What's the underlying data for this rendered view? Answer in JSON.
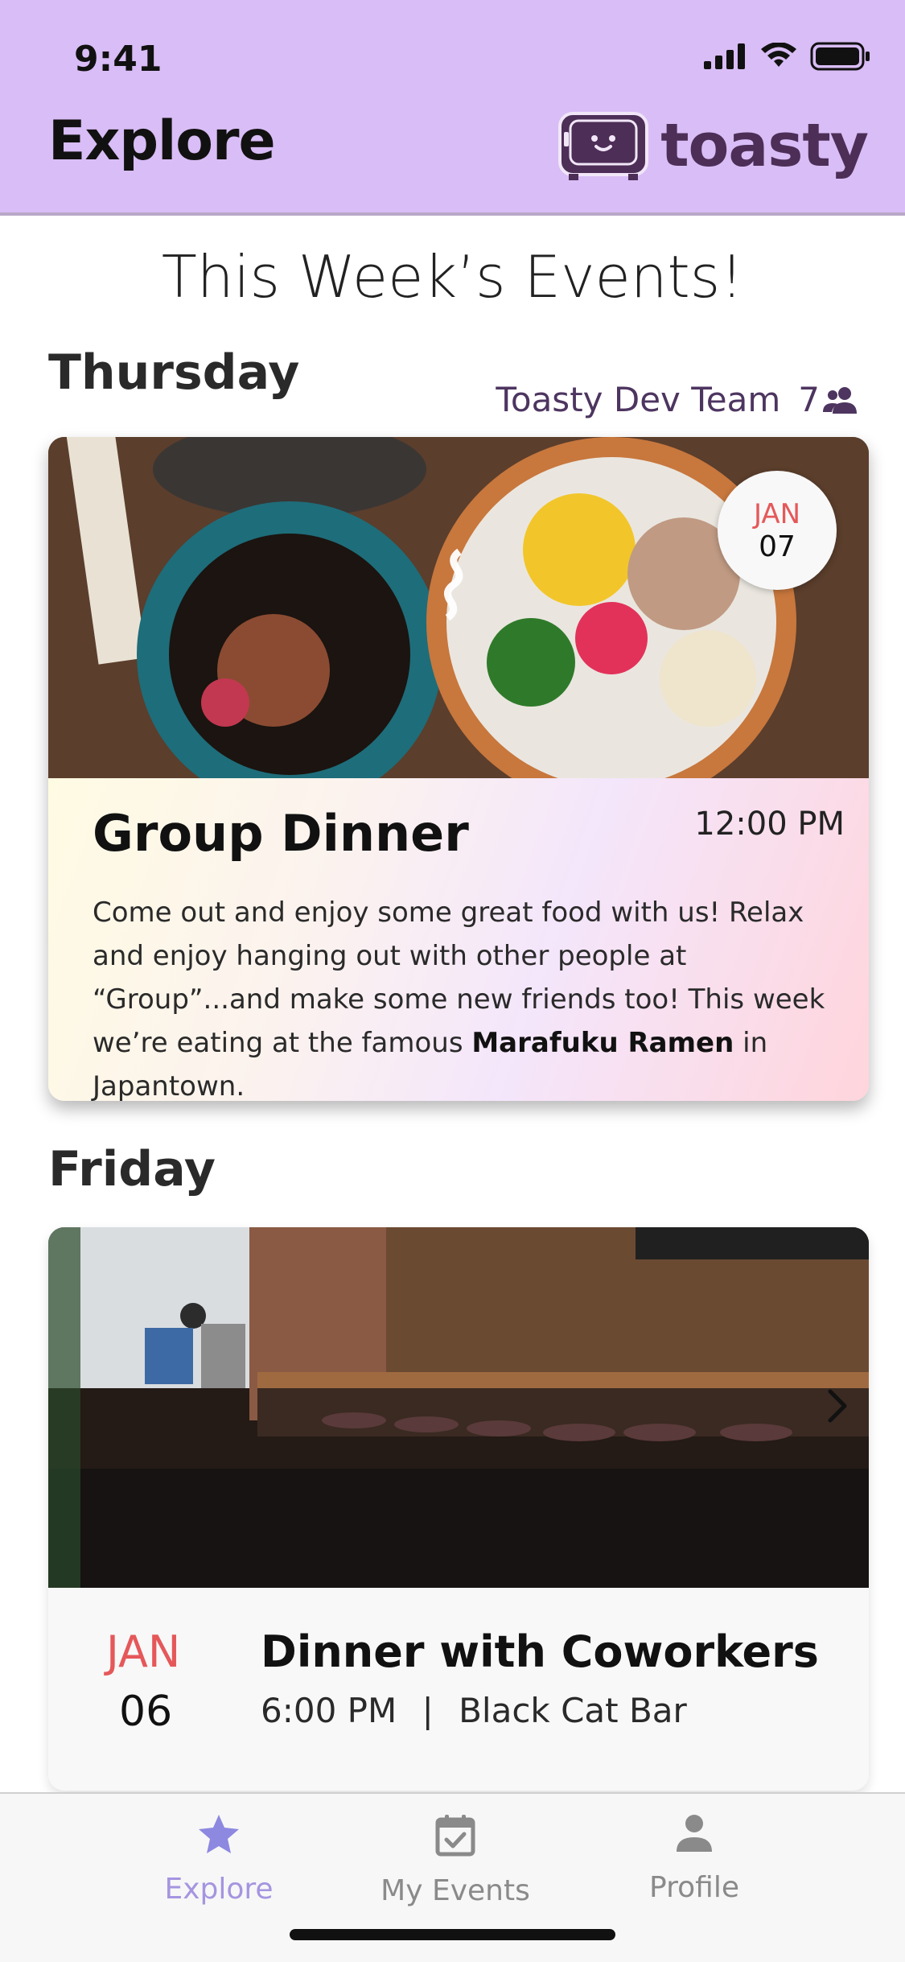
{
  "status_bar": {
    "time": "9:41"
  },
  "header": {
    "title": "Explore",
    "logo_text": "toasty"
  },
  "main": {
    "section_title": "This Week’s Events!",
    "days": [
      {
        "label": "Thursday",
        "group_name": "Toasty Dev Team",
        "member_count": "7",
        "event": {
          "title": "Group Dinner",
          "time": "12:00 PM",
          "month": "JAN",
          "day": "07",
          "description_parts": [
            "Come out and enjoy some great food with us! Relax and enjoy hanging out with other people at “Group”...and make some new friends too! This week we’re eating at the famous ",
            "Marafuku Ramen",
            " in Japantown."
          ]
        }
      },
      {
        "label": "Friday",
        "event": {
          "title": "Dinner with Coworkers",
          "month": "JAN",
          "day": "06",
          "time": "6:00 PM",
          "separator": "|",
          "venue": "Black Cat Bar"
        }
      }
    ]
  },
  "tabs": [
    {
      "label": "Explore",
      "icon": "star-icon",
      "active": true
    },
    {
      "label": "My Events",
      "icon": "calendar-check-icon",
      "active": false
    },
    {
      "label": "Profile",
      "icon": "person-icon",
      "active": false
    }
  ],
  "colors": {
    "header_bg": "#d9bdf6",
    "brand": "#4d2e57",
    "accent_red": "#e5585a",
    "active_tab": "#a595e0"
  }
}
